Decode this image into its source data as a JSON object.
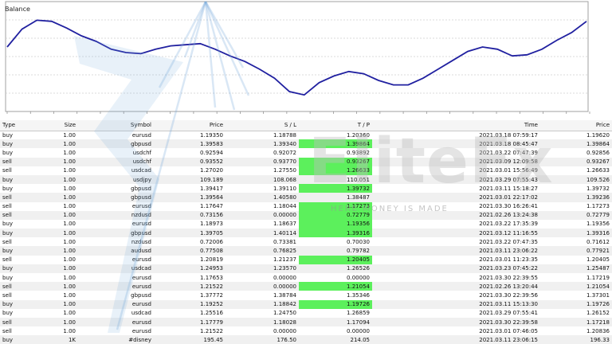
{
  "chart": {
    "title": "Balance",
    "line_color": "#2020a0",
    "points": [
      40,
      56,
      64,
      63,
      57,
      50,
      45,
      38,
      35,
      34,
      38,
      41,
      42,
      43,
      38,
      32,
      27,
      20,
      12,
      0,
      -3,
      8,
      14,
      18,
      16,
      10,
      6,
      6,
      12,
      20,
      28,
      36,
      40,
      38,
      32,
      33,
      38,
      46,
      53,
      63
    ]
  },
  "table": {
    "headers": {
      "type": "Type",
      "size": "Size",
      "symbol": "Symbol",
      "price": "Price",
      "sl": "S / L",
      "tp": "T / P",
      "time": "Time",
      "close_price": "Price"
    },
    "rows": [
      {
        "type": "buy",
        "size": "1.00",
        "symbol": "eurusd",
        "price": "1.19350",
        "sl": "1.18788",
        "tp": "1.20360",
        "tp_hit": false,
        "time": "2021.03.18 07:59:17",
        "close": "1.19620"
      },
      {
        "type": "buy",
        "size": "1.00",
        "symbol": "gbpusd",
        "price": "1.39583",
        "sl": "1.39340",
        "tp": "1.39864",
        "tp_hit": true,
        "time": "2021.03.18 08:45:47",
        "close": "1.39864"
      },
      {
        "type": "buy",
        "size": "1.00",
        "symbol": "usdchf",
        "price": "0.92594",
        "sl": "0.92072",
        "tp": "0.93892",
        "tp_hit": false,
        "time": "2021.03.22 07:47:39",
        "close": "0.92856"
      },
      {
        "type": "sell",
        "size": "1.00",
        "symbol": "usdchf",
        "price": "0.93552",
        "sl": "0.93770",
        "tp": "0.93267",
        "tp_hit": true,
        "time": "2021.03.09 12:09:58",
        "close": "0.93267"
      },
      {
        "type": "sell",
        "size": "1.00",
        "symbol": "usdcad",
        "price": "1.27020",
        "sl": "1.27550",
        "tp": "1.26633",
        "tp_hit": true,
        "time": "2021.03.01 15:56:49",
        "close": "1.26633"
      },
      {
        "type": "buy",
        "size": "1.00",
        "symbol": "usdjpy",
        "price": "109.189",
        "sl": "108.068",
        "tp": "110.051",
        "tp_hit": false,
        "time": "2021.03.29 07:55:43",
        "close": "109.526"
      },
      {
        "type": "buy",
        "size": "1.00",
        "symbol": "gbpusd",
        "price": "1.39417",
        "sl": "1.39110",
        "tp": "1.39732",
        "tp_hit": true,
        "time": "2021.03.11 15:18:27",
        "close": "1.39732"
      },
      {
        "type": "sell",
        "size": "1.00",
        "symbol": "gbpusd",
        "price": "1.39564",
        "sl": "1.40580",
        "tp": "1.38487",
        "tp_hit": false,
        "time": "2021.03.01 22:17:02",
        "close": "1.39236"
      },
      {
        "type": "sell",
        "size": "1.00",
        "symbol": "eurusd",
        "price": "1.17647",
        "sl": "1.18044",
        "tp": "1.17273",
        "tp_hit": true,
        "time": "2021.03.30 16:26:41",
        "close": "1.17273"
      },
      {
        "type": "sell",
        "size": "1.00",
        "symbol": "nzdusd",
        "price": "0.73156",
        "sl": "0.00000",
        "tp": "0.72779",
        "tp_hit": true,
        "time": "2021.02.26 13:24:38",
        "close": "0.72779"
      },
      {
        "type": "buy",
        "size": "1.00",
        "symbol": "eurusd",
        "price": "1.18973",
        "sl": "1.18637",
        "tp": "1.19356",
        "tp_hit": true,
        "time": "2021.03.22 17:35:39",
        "close": "1.19356"
      },
      {
        "type": "buy",
        "size": "1.00",
        "symbol": "gbpusd",
        "price": "1.39705",
        "sl": "1.40114",
        "tp": "1.39316",
        "tp_hit": true,
        "time": "2021.03.12 11:16:55",
        "close": "1.39316"
      },
      {
        "type": "sell",
        "size": "1.00",
        "symbol": "nzdusd",
        "price": "0.72006",
        "sl": "0.73381",
        "tp": "0.70030",
        "tp_hit": false,
        "time": "2021.03.22 07:47:35",
        "close": "0.71612"
      },
      {
        "type": "buy",
        "size": "1.00",
        "symbol": "audusd",
        "price": "0.77508",
        "sl": "0.76825",
        "tp": "0.79782",
        "tp_hit": false,
        "time": "2021.03.11 23:06:22",
        "close": "0.77921"
      },
      {
        "type": "sell",
        "size": "1.00",
        "symbol": "eurusd",
        "price": "1.20819",
        "sl": "1.21237",
        "tp": "1.20405",
        "tp_hit": true,
        "time": "2021.03.01 11:23:35",
        "close": "1.20405"
      },
      {
        "type": "buy",
        "size": "1.00",
        "symbol": "usdcad",
        "price": "1.24953",
        "sl": "1.23570",
        "tp": "1.26526",
        "tp_hit": false,
        "time": "2021.03.23 07:45:22",
        "close": "1.25487"
      },
      {
        "type": "buy",
        "size": "1.00",
        "symbol": "eurusd",
        "price": "1.17653",
        "sl": "0.00000",
        "tp": "0.00000",
        "tp_hit": false,
        "time": "2021.03.30 22:39:55",
        "close": "1.17219"
      },
      {
        "type": "sell",
        "size": "1.00",
        "symbol": "eurusd",
        "price": "1.21522",
        "sl": "0.00000",
        "tp": "1.21054",
        "tp_hit": true,
        "time": "2021.02.26 13:20:44",
        "close": "1.21054"
      },
      {
        "type": "sell",
        "size": "1.00",
        "symbol": "gbpusd",
        "price": "1.37772",
        "sl": "1.38784",
        "tp": "1.35346",
        "tp_hit": false,
        "time": "2021.03.30 22:39:56",
        "close": "1.37301"
      },
      {
        "type": "buy",
        "size": "1.00",
        "symbol": "eurusd",
        "price": "1.19252",
        "sl": "1.18842",
        "tp": "1.19726",
        "tp_hit": true,
        "time": "2021.03.11 15:13:30",
        "close": "1.19726"
      },
      {
        "type": "buy",
        "size": "1.00",
        "symbol": "usdcad",
        "price": "1.25516",
        "sl": "1.24750",
        "tp": "1.26859",
        "tp_hit": false,
        "time": "2021.03.29 07:55:41",
        "close": "1.26152"
      },
      {
        "type": "sell",
        "size": "1.00",
        "symbol": "eurusd",
        "price": "1.17779",
        "sl": "1.18028",
        "tp": "1.17094",
        "tp_hit": false,
        "time": "2021.03.30 22:39:58",
        "close": "1.17218"
      },
      {
        "type": "sell",
        "size": "1.00",
        "symbol": "eurusd",
        "price": "1.21522",
        "sl": "0.00000",
        "tp": "0.00000",
        "tp_hit": false,
        "time": "2021.03.01 07:46:05",
        "close": "1.20836"
      },
      {
        "type": "buy",
        "size": "1K",
        "symbol": "#disney",
        "price": "195.45",
        "sl": "176.50",
        "tp": "214.05",
        "tp_hit": false,
        "time": "2021.03.11 23:06:15",
        "close": "196.33"
      }
    ]
  },
  "watermark": {
    "text": "EliteFx",
    "tagline": "HERE MONEY IS MADE"
  },
  "colors": {
    "tp_hit": "#5cf05c",
    "row_alt": "#f0f0f0"
  }
}
